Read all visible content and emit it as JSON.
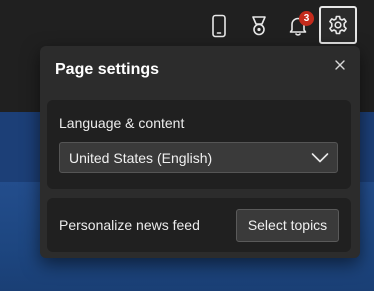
{
  "header": {
    "icons": [
      "phone-icon",
      "rewards-trophy-icon",
      "bell-icon",
      "gear-icon"
    ],
    "notifications": {
      "count": "3"
    }
  },
  "panel": {
    "title": "Page settings",
    "language": {
      "label": "Language & content",
      "selected": "United States (English)"
    },
    "news": {
      "label": "Personalize news feed",
      "button": "Select topics"
    }
  },
  "colors": {
    "badge": "#c42b1c",
    "panel": "#2c2c2c",
    "card": "#202020",
    "band": "#1c3f77"
  }
}
